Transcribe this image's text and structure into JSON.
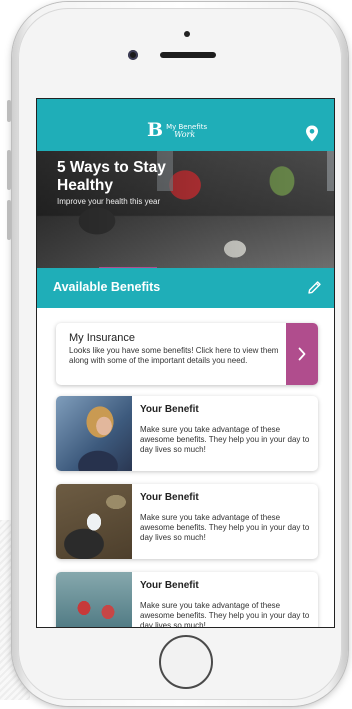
{
  "app": {
    "logo_mark": "B",
    "logo_line1": "My Benefits",
    "logo_line2": "Work"
  },
  "hero": {
    "title": "5 Ways to Stay Healthy",
    "subtitle": "Improve your health this year"
  },
  "section": {
    "title": "Available Benefits"
  },
  "insurance": {
    "title": "My Insurance",
    "description": "Looks like you have some benefits! Click here to view them along with some of the important details you need."
  },
  "benefits": [
    {
      "title": "Your Benefit",
      "description": "Make sure you take advantage of these awesome benefits. They help you in your day to day lives so much!"
    },
    {
      "title": "Your Benefit",
      "description": "Make sure you take advantage of these awesome benefits. They help you in your day to day lives so much!"
    },
    {
      "title": "Your Benefit",
      "description": "Make sure you take advantage of these awesome benefits. They help you in your day to day lives so much!"
    }
  ],
  "colors": {
    "primary": "#1faeb8",
    "accent": "#b04d8d",
    "indicator": "#b04d8d"
  },
  "icons": [
    "location-pin-icon",
    "edit-pencil-icon",
    "chevron-right-icon"
  ]
}
